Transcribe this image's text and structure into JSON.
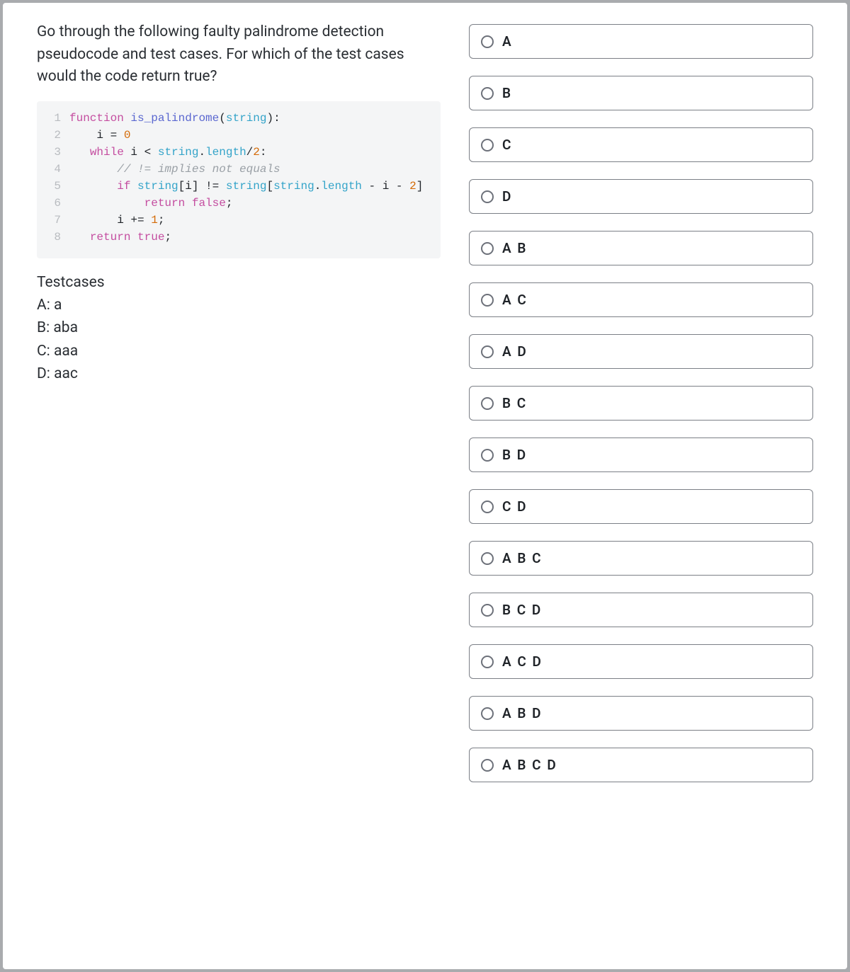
{
  "question": "Go through the following faulty palindrome detection pseudocode and test cases. For which of the test cases would the code return true?",
  "code": {
    "lines": [
      {
        "n": "1",
        "html": "<span class='tok-keyword'>function</span> <span class='tok-func'>is_palindrome</span>(<span class='tok-param'>string</span>):"
      },
      {
        "n": "2",
        "html": "    i = <span class='tok-number'>0</span>"
      },
      {
        "n": "3",
        "html": "   <span class='tok-keyword'>while</span> i &lt; <span class='tok-param'>string</span>.<span class='tok-attr'>length</span>/<span class='tok-number'>2</span>:"
      },
      {
        "n": "4",
        "html": "       <span class='tok-comment'>// != implies not equals</span>"
      },
      {
        "n": "5",
        "html": "       <span class='tok-keyword'>if</span> <span class='tok-param'>string</span>[i] != <span class='tok-param'>string</span>[<span class='tok-param'>string</span>.<span class='tok-attr'>length</span> - i - <span class='tok-number'>2</span>]"
      },
      {
        "n": "6",
        "html": "           <span class='tok-keyword'>return</span> <span class='tok-bool'>false</span>;"
      },
      {
        "n": "7",
        "html": "       i += <span class='tok-number'>1</span>;"
      },
      {
        "n": "8",
        "html": "   <span class='tok-keyword'>return</span> <span class='tok-bool'>true</span>;"
      }
    ]
  },
  "testcases_header": "Testcases",
  "testcases": [
    {
      "label": "A: a"
    },
    {
      "label": "B: aba"
    },
    {
      "label": "C: aaa"
    },
    {
      "label": "D: aac"
    }
  ],
  "options": [
    {
      "label": "A"
    },
    {
      "label": "B"
    },
    {
      "label": "C"
    },
    {
      "label": "D"
    },
    {
      "label": "A B"
    },
    {
      "label": "A C"
    },
    {
      "label": "A D"
    },
    {
      "label": "B C"
    },
    {
      "label": "B D"
    },
    {
      "label": "C D"
    },
    {
      "label": "A B C"
    },
    {
      "label": "B C D"
    },
    {
      "label": "A C D"
    },
    {
      "label": "A B D"
    },
    {
      "label": "A B C D"
    }
  ]
}
